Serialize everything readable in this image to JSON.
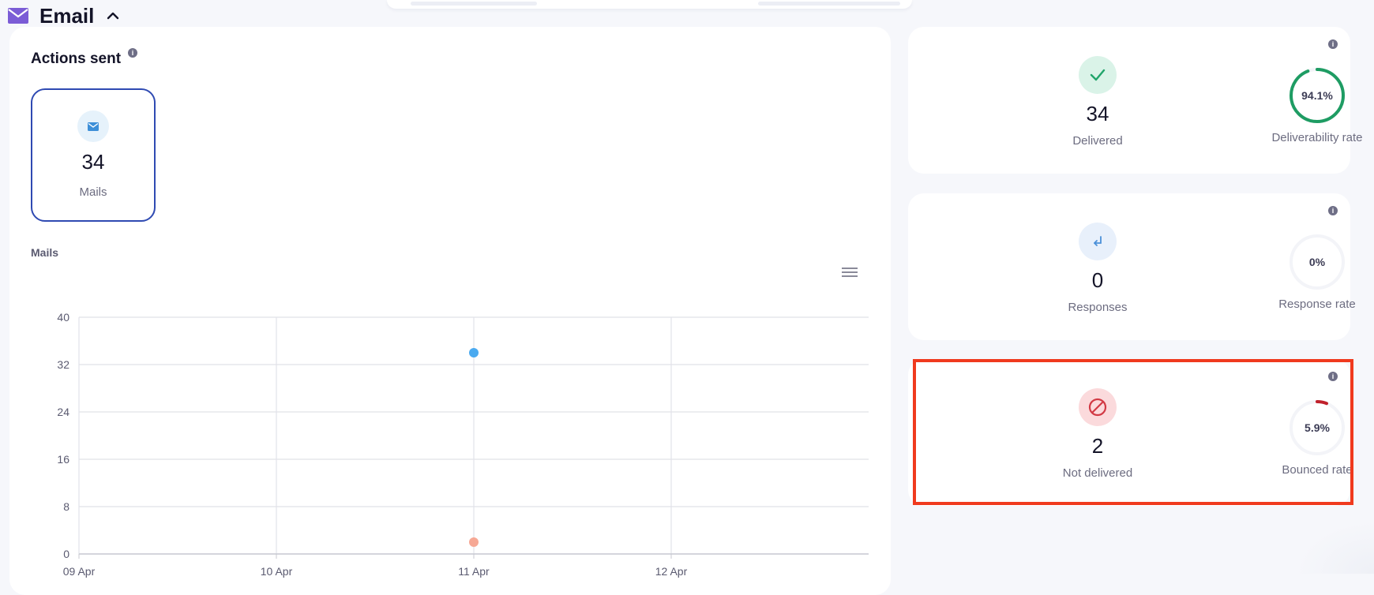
{
  "header": {
    "title": "Email",
    "mail_icon": "envelope-icon",
    "collapse_icon": "chevron-up-icon",
    "accent": "#7b5cd6"
  },
  "actions": {
    "title": "Actions sent",
    "info_icon": "info-icon",
    "mails_tile": {
      "value": "34",
      "label": "Mails",
      "icon": "envelope-icon",
      "border_color": "#2f4ab2"
    }
  },
  "chart_data": {
    "type": "scatter",
    "title": "",
    "ylabel": "Mails",
    "xlabel": "",
    "x_ticks": [
      "09 Apr",
      "10 Apr",
      "11 Apr",
      "12 Apr"
    ],
    "y_ticks": [
      "0",
      "8",
      "16",
      "24",
      "32",
      "40"
    ],
    "ylim": [
      0,
      40
    ],
    "grid": true,
    "legend_position": "bottom",
    "series": [
      {
        "name": "Sent",
        "color": "#4aaaf0",
        "points": [
          {
            "x": "11 Apr",
            "y": 34
          }
        ]
      },
      {
        "name": "Not delivered",
        "color": "#f6a895",
        "points": [
          {
            "x": "11 Apr",
            "y": 2
          }
        ]
      }
    ]
  },
  "stats": {
    "delivered": {
      "value": "34",
      "label": "Delivered",
      "icon": "checkmark-icon",
      "icon_bg": "#daf3e8",
      "icon_color": "#21a56b"
    },
    "deliverability": {
      "value": "94.1%",
      "label": "Deliverability rate",
      "fraction": 0.941,
      "ring_color": "#1e9c63"
    },
    "responses": {
      "value": "0",
      "label": "Responses",
      "icon": "reply-arrow-icon",
      "icon_bg": "#e8f0fb",
      "icon_color": "#4a90d9"
    },
    "response_rate": {
      "value": "0%",
      "label": "Response rate",
      "fraction": 0
    },
    "not_delivered": {
      "value": "2",
      "label": "Not delivered",
      "icon": "blocked-icon",
      "icon_bg": "#fbdadc",
      "icon_color": "#d23a45"
    },
    "bounced_rate": {
      "value": "5.9%",
      "label": "Bounced rate",
      "fraction": 0.059,
      "ring_color": "#c0212b"
    }
  },
  "highlight_color": "#f03a1e"
}
